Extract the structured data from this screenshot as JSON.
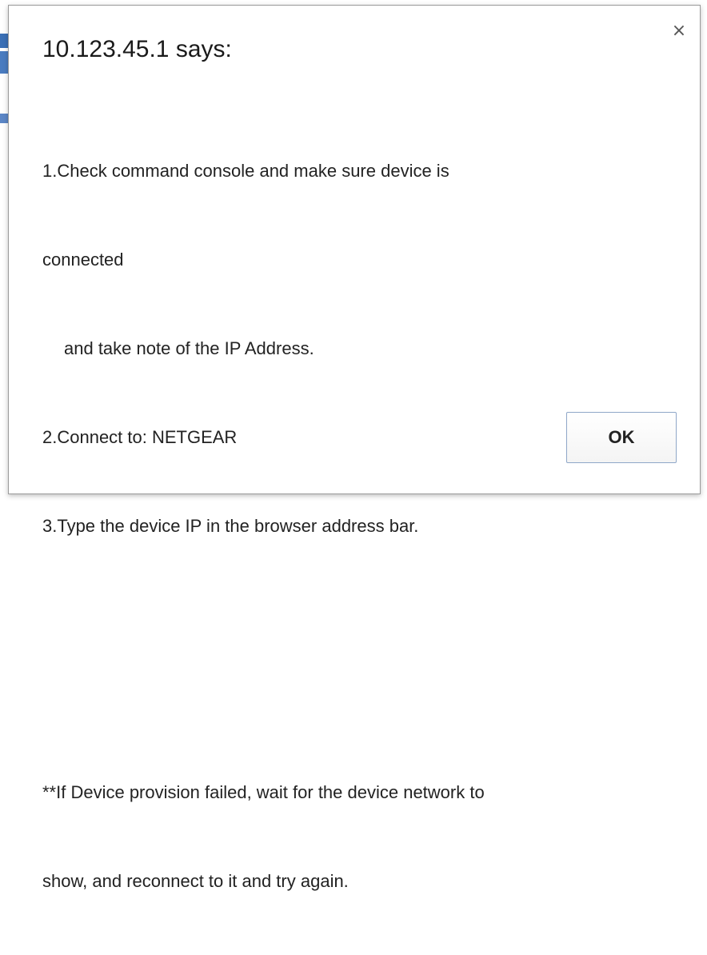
{
  "dialog": {
    "title": "10.123.45.1 says:",
    "close_glyph": "×",
    "message_lines": [
      "1.Check command console and make sure device is",
      "connected",
      "and take note of the IP Address.",
      "2.Connect to: NETGEAR",
      "3.Type the device IP in the browser address bar.",
      "",
      "",
      "**If Device provision failed, wait for the device network to",
      "show, and reconnect to it and try again."
    ],
    "ok_label": "OK"
  },
  "colors": {
    "button_border": "#8fa7c8",
    "background_accent": "#3a6fb5"
  },
  "icons": {
    "close": "close-icon"
  }
}
